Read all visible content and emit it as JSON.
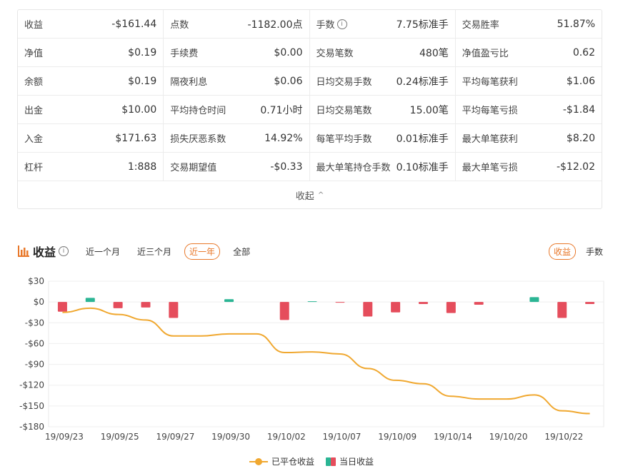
{
  "stats": {
    "rows": [
      [
        {
          "label": "收益",
          "value": "-$161.44"
        },
        {
          "label": "点数",
          "value": "-1182.00点"
        },
        {
          "label": "手数",
          "value": "7.75标准手",
          "info": true
        },
        {
          "label": "交易胜率",
          "value": "51.87%"
        }
      ],
      [
        {
          "label": "净值",
          "value": "$0.19"
        },
        {
          "label": "手续费",
          "value": "$0.00"
        },
        {
          "label": "交易笔数",
          "value": "480笔"
        },
        {
          "label": "净值盈亏比",
          "value": "0.62"
        }
      ],
      [
        {
          "label": "余额",
          "value": "$0.19"
        },
        {
          "label": "隔夜利息",
          "value": "$0.06"
        },
        {
          "label": "日均交易手数",
          "value": "0.24标准手"
        },
        {
          "label": "平均每笔获利",
          "value": "$1.06"
        }
      ],
      [
        {
          "label": "出金",
          "value": "$10.00"
        },
        {
          "label": "平均持仓时间",
          "value": "0.71小时"
        },
        {
          "label": "日均交易笔数",
          "value": "15.00笔"
        },
        {
          "label": "平均每笔亏损",
          "value": "-$1.84"
        }
      ],
      [
        {
          "label": "入金",
          "value": "$171.63"
        },
        {
          "label": "损失厌恶系数",
          "value": "14.92%"
        },
        {
          "label": "每笔平均手数",
          "value": "0.01标准手"
        },
        {
          "label": "最大单笔获利",
          "value": "$8.20"
        }
      ],
      [
        {
          "label": "杠杆",
          "value": "1:888"
        },
        {
          "label": "交易期望值",
          "value": "-$0.33"
        },
        {
          "label": "最大单笔持仓手数",
          "value": "0.10标准手"
        },
        {
          "label": "最大单笔亏损",
          "value": "-$12.02"
        }
      ]
    ],
    "collapse_label": "收起"
  },
  "chart_header": {
    "title": "收益",
    "filters": [
      "近一个月",
      "近三个月",
      "近一年",
      "全部"
    ],
    "active_filter": 2,
    "right_tabs": [
      "收益",
      "手数"
    ],
    "active_right_tab": 0
  },
  "colors": {
    "accent": "#e8782a",
    "line": "#f0a830",
    "positive": "#2bb594",
    "negative": "#e54d5c"
  },
  "chart_data": {
    "type": "bar+line",
    "ylim": [
      -180,
      30
    ],
    "yticks": [
      "$30",
      "$0",
      "-$30",
      "-$60",
      "-$90",
      "-$120",
      "-$150",
      "-$180"
    ],
    "ytick_values": [
      30,
      0,
      -30,
      -60,
      -90,
      -120,
      -150,
      -180
    ],
    "xticks": [
      "19/09/23",
      "19/09/25",
      "19/09/27",
      "19/09/30",
      "19/10/02",
      "19/10/07",
      "19/10/09",
      "19/10/14",
      "19/10/20",
      "19/10/22"
    ],
    "daily_index": [
      0,
      1,
      2,
      3,
      4,
      5,
      6,
      7,
      8,
      9,
      10,
      11,
      12,
      13,
      14,
      15,
      16,
      17,
      18,
      19
    ],
    "series": [
      {
        "name": "已平仓收益",
        "kind": "line",
        "values": [
          -15,
          -9,
          -18,
          -26,
          -49,
          -49,
          -46,
          -46,
          -73,
          -72,
          -75,
          -96,
          -113,
          -118,
          -136,
          -140,
          -140,
          -134,
          -157,
          -161
        ]
      },
      {
        "name": "当日收益",
        "kind": "bar",
        "values": [
          -14,
          6,
          -9,
          -8,
          -23,
          0,
          4,
          0,
          -26,
          1,
          -1,
          -21,
          -15,
          -3,
          -16,
          -4,
          0,
          7,
          -23,
          -3
        ]
      }
    ]
  },
  "legend": [
    "已平仓收益",
    "当日收益"
  ]
}
